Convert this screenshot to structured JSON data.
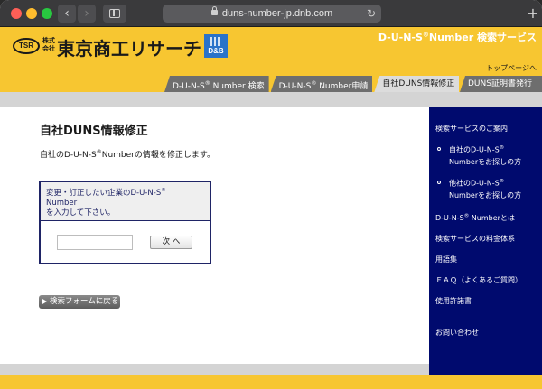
{
  "browser": {
    "url": "duns-number-jp.dnb.com",
    "back_glyph": "‹",
    "forward_glyph": "›",
    "reload_glyph": "↻",
    "newtab_glyph": "+"
  },
  "header": {
    "logo_mark": "TSR",
    "logo_kaisha": "株式会社",
    "logo_name": "東京商工リサーチ",
    "partner_logo": "D&B",
    "service_title_pre": "D-U-N-S",
    "service_title_sup": "®",
    "service_title_post": "Number 検索サービス",
    "top_page_link": "トップページへ"
  },
  "tabs": [
    {
      "pre": "D-U-N-S",
      "sup": "®",
      "post": " Number 検索",
      "active": false
    },
    {
      "pre": "D-U-N-S",
      "sup": "®",
      "post": " Number申請",
      "active": false
    },
    {
      "pre": "",
      "sup": "",
      "post": "自社DUNS情報修正",
      "active": true
    },
    {
      "pre": "",
      "sup": "",
      "post": "DUNS証明書発行",
      "active": false
    }
  ],
  "main": {
    "title": "自社DUNS情報修正",
    "desc_pre": "自社のD-U-N-S",
    "desc_sup": "®",
    "desc_post": "Numberの情報を修正します。",
    "form": {
      "prompt_line1_pre": "変更・訂正したい企業のD-U-N-S",
      "prompt_line1_sup": "®",
      "prompt_line2": "Number",
      "prompt_line3": "を入力して下さい。",
      "input_value": "",
      "next_label": "次 へ"
    },
    "back_label": "検索フォームに戻る"
  },
  "sidebar": {
    "heading": "検索サービスのご案内",
    "sub1_line1_pre": "自社のD-U-N-S",
    "sub1_line1_sup": "®",
    "sub1_line2": "Numberをお探しの方",
    "sub2_line1_pre": "他社のD-U-N-S",
    "sub2_line1_sup": "®",
    "sub2_line2": "Numberをお探しの方",
    "about_pre": "D-U-N-S",
    "about_sup": "®",
    "about_post": " Numberとは",
    "pricing": "検索サービスの料金体系",
    "glossary": "用語集",
    "faq": "ＦＡＱ（よくあるご質問）",
    "license": "使用許諾書",
    "contact": "お問い合わせ"
  },
  "colors": {
    "brand_yellow": "#f7c631",
    "sidebar_navy": "#000a6e",
    "tab_gray": "#6e6e6e",
    "tab_active": "#dcdcdc"
  }
}
